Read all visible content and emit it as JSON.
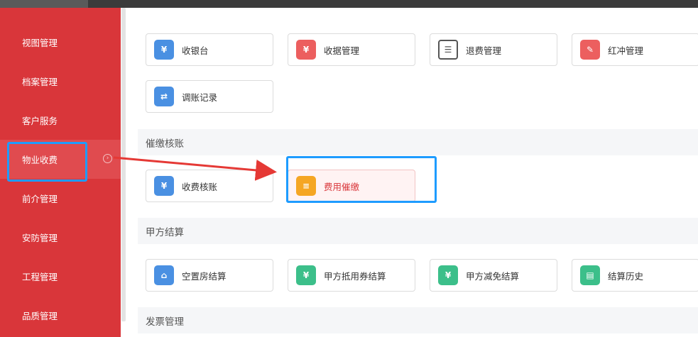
{
  "sidebar": {
    "items": [
      {
        "label": "视图管理"
      },
      {
        "label": "档案管理"
      },
      {
        "label": "客户服务"
      },
      {
        "label": "物业收费",
        "active": true
      },
      {
        "label": "前介管理"
      },
      {
        "label": "安防管理"
      },
      {
        "label": "工程管理"
      },
      {
        "label": "品质管理"
      }
    ]
  },
  "cards_top": [
    {
      "label": "收银台",
      "icon": "cash-register-icon",
      "color": "#4a90e2"
    },
    {
      "label": "收据管理",
      "icon": "receipt-icon",
      "color": "#ec5f5f"
    },
    {
      "label": "退费管理",
      "icon": "refund-list-icon",
      "color": "#555555"
    },
    {
      "label": "红冲管理",
      "icon": "red-reversal-icon",
      "color": "#ec5f5f"
    },
    {
      "label": "调账记录",
      "icon": "account-adjust-icon",
      "color": "#4a90e2"
    }
  ],
  "sections": [
    {
      "title": "催缴核账",
      "cards": [
        {
          "label": "收费核账",
          "icon": "fee-reconcile-icon",
          "color": "#4a90e2"
        },
        {
          "label": "费用催缴",
          "icon": "fee-reminder-icon",
          "color": "#f5a623",
          "highlighted": true
        }
      ]
    },
    {
      "title": "甲方结算",
      "cards": [
        {
          "label": "空置房结算",
          "icon": "vacant-house-icon",
          "color": "#4a90e2"
        },
        {
          "label": "甲方抵用券结算",
          "icon": "voucher-icon",
          "color": "#3cbf8a"
        },
        {
          "label": "甲方减免结算",
          "icon": "discount-icon",
          "color": "#3cbf8a"
        },
        {
          "label": "结算历史",
          "icon": "settlement-history-icon",
          "color": "#3cbf8a"
        }
      ]
    },
    {
      "title": "发票管理",
      "cards": []
    }
  ],
  "annotation": {
    "color": "#1e9cff",
    "arrow_color": "#e53935"
  }
}
